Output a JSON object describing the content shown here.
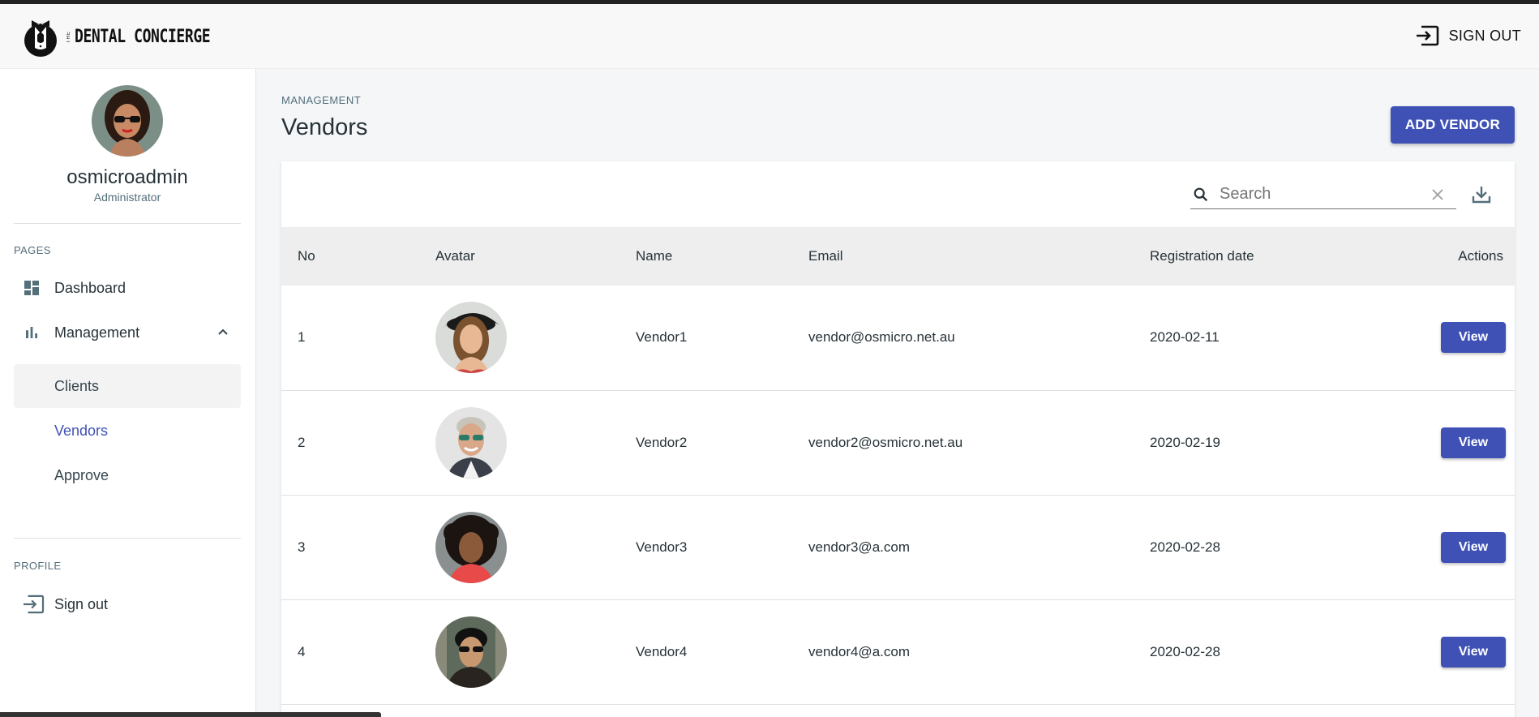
{
  "brand": {
    "the": "THE",
    "name": "DENTAL CONCIERGE"
  },
  "header": {
    "signout_label": "SIGN OUT"
  },
  "sidebar": {
    "user": {
      "name": "osmicroadmin",
      "role": "Administrator"
    },
    "pages_label": "PAGES",
    "items": [
      {
        "label": "Dashboard",
        "icon": "dashboard-icon"
      },
      {
        "label": "Management",
        "icon": "bar-chart-icon",
        "expanded": true
      }
    ],
    "sub_items": [
      {
        "label": "Clients"
      },
      {
        "label": "Vendors"
      },
      {
        "label": "Approve"
      }
    ],
    "profile_label": "PROFILE",
    "signout_label": "Sign out"
  },
  "main": {
    "breadcrumb": "MANAGEMENT",
    "title": "Vendors",
    "add_button": "ADD VENDOR",
    "search": {
      "placeholder": "Search",
      "value": ""
    },
    "table": {
      "columns": [
        "No",
        "Avatar",
        "Name",
        "Email",
        "Registration date",
        "Actions"
      ],
      "rows": [
        {
          "no": "1",
          "name": "Vendor1",
          "email": "vendor@osmicro.net.au",
          "date": "2020-02-11",
          "action": "View"
        },
        {
          "no": "2",
          "name": "Vendor2",
          "email": "vendor2@osmicro.net.au",
          "date": "2020-02-19",
          "action": "View"
        },
        {
          "no": "3",
          "name": "Vendor3",
          "email": "vendor3@a.com",
          "date": "2020-02-28",
          "action": "View"
        },
        {
          "no": "4",
          "name": "Vendor4",
          "email": "vendor4@a.com",
          "date": "2020-02-28",
          "action": "View"
        }
      ]
    }
  },
  "colors": {
    "primary": "#3f51b5",
    "text": "#263238",
    "muted": "#546e7a",
    "header_row": "#eeeeee"
  }
}
